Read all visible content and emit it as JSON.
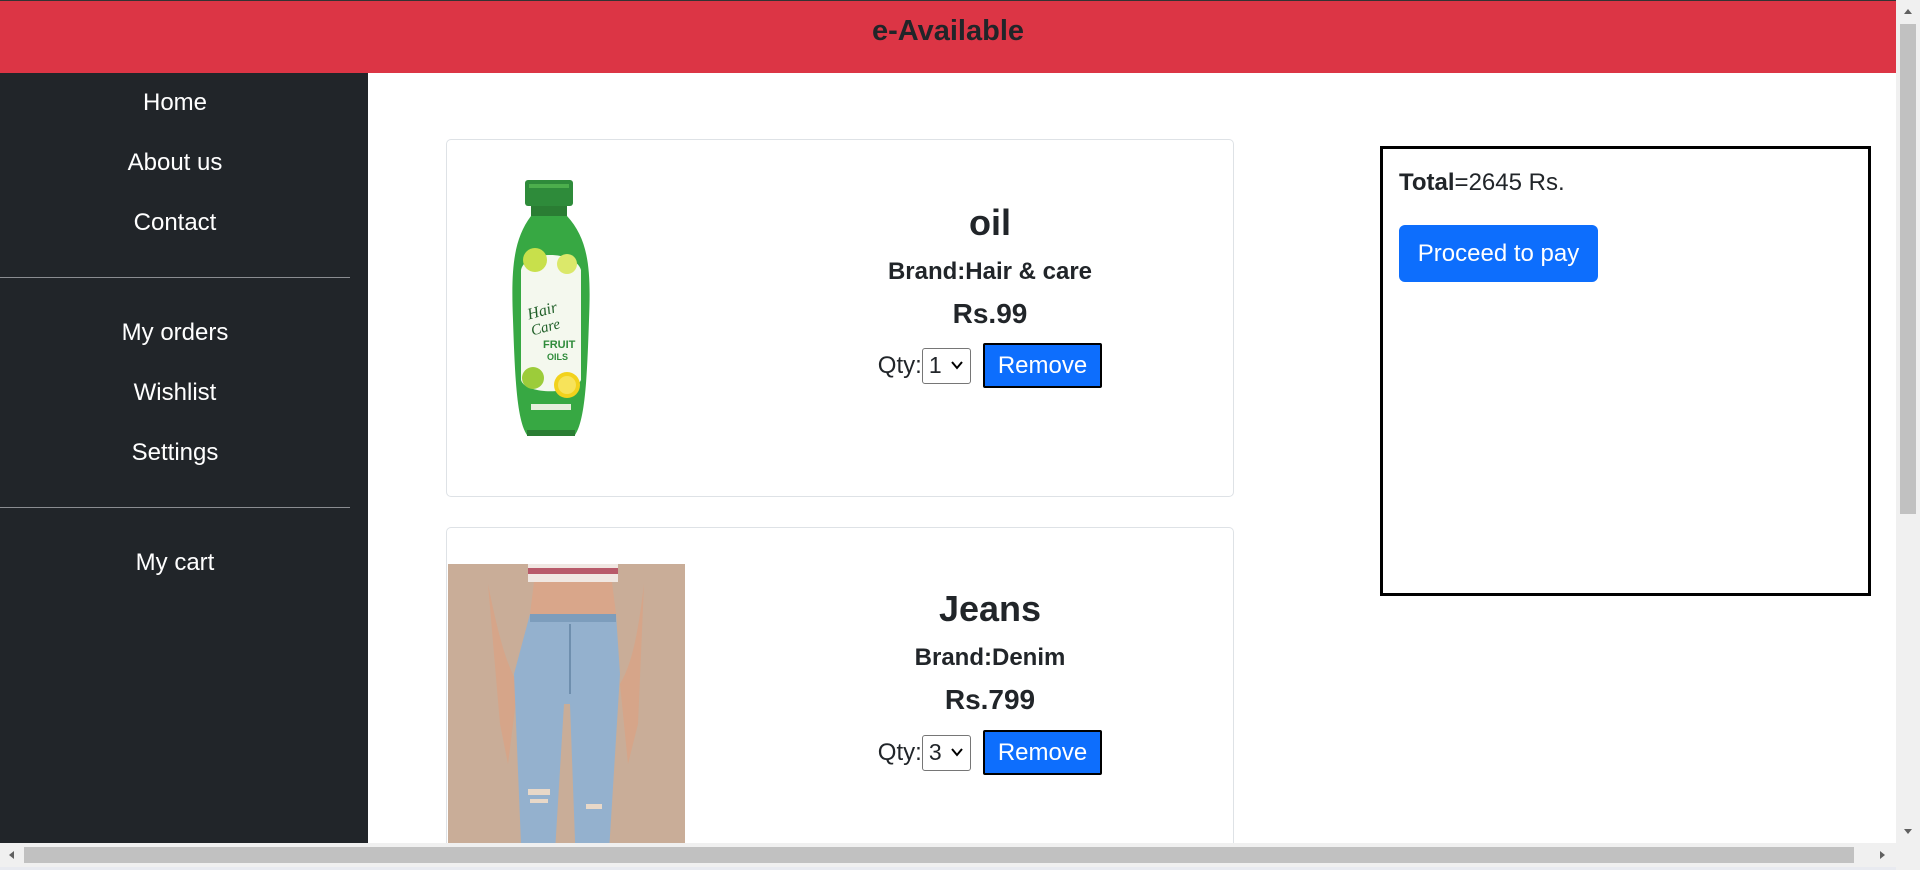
{
  "header": {
    "title": "e-Available"
  },
  "sidebar": {
    "groups": [
      [
        "Home",
        "About us",
        "Contact"
      ],
      [
        "My orders",
        "Wishlist",
        "Settings"
      ],
      [
        "My cart"
      ]
    ]
  },
  "cart": {
    "items": [
      {
        "name": "oil",
        "brand": "Brand:Hair & care",
        "price": "Rs.99",
        "qty_label": "Qty:",
        "qty": "1",
        "remove_label": "Remove",
        "image": "hair-oil-bottle"
      },
      {
        "name": "Jeans",
        "brand": "Brand:Denim",
        "price": "Rs.799",
        "qty_label": "Qty:",
        "qty": "3",
        "remove_label": "Remove",
        "image": "jeans-photo"
      }
    ]
  },
  "summary": {
    "total_label": "Total",
    "total_value": "=2645 Rs.",
    "pay_label": "Proceed to pay"
  },
  "colors": {
    "header_bg": "#dc3545",
    "sidebar_bg": "#212529",
    "primary_button": "#0d6efd"
  }
}
